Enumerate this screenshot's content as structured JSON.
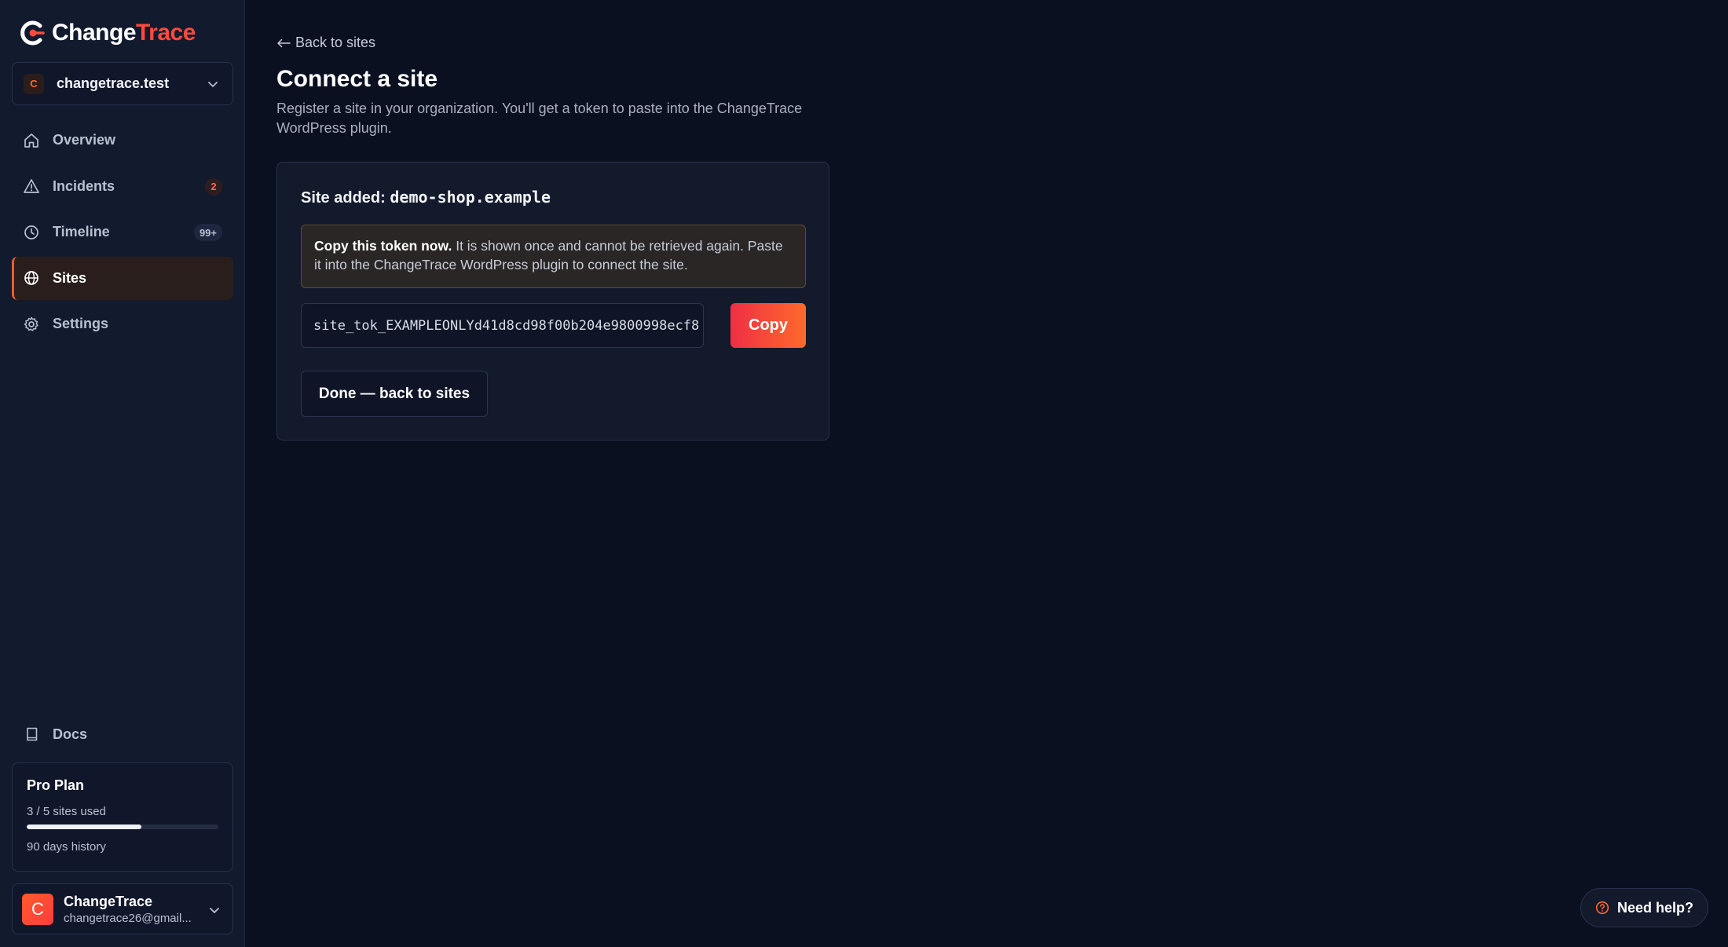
{
  "brand": {
    "name_part1": "Change",
    "name_part2": "Trace",
    "accent": "#ff4a3d"
  },
  "org": {
    "avatar_letter": "C",
    "name": "changetrace.test"
  },
  "nav": [
    {
      "label": "Overview",
      "icon": "home-icon",
      "badge": ""
    },
    {
      "label": "Incidents",
      "icon": "warning-icon",
      "badge": "2"
    },
    {
      "label": "Timeline",
      "icon": "clock-icon",
      "badge": "99+"
    },
    {
      "label": "Sites",
      "icon": "globe-icon",
      "badge": "",
      "active": true
    },
    {
      "label": "Settings",
      "icon": "gear-icon",
      "badge": ""
    }
  ],
  "docs": {
    "label": "Docs",
    "icon": "book-icon"
  },
  "plan": {
    "title": "Pro Plan",
    "usage": "3 / 5 sites used",
    "used": 3,
    "total": 5,
    "history": "90 days history"
  },
  "account": {
    "avatar_letter": "C",
    "name": "ChangeTrace",
    "email": "changetrace26@gmail..."
  },
  "page": {
    "back_label": "Back to sites",
    "title": "Connect a site",
    "description": "Register a site in your organization. You'll get a token to paste into the ChangeTrace WordPress plugin."
  },
  "card": {
    "head_prefix": "Site added:",
    "site_name": "demo-shop.example",
    "warning_bold": "Copy this token now.",
    "warning_text": "It is shown once and cannot be retrieved again. Paste it into the ChangeTrace WordPress plugin to connect the site.",
    "token": "site_tok_EXAMPLEONLYd41d8cd98f00b204e9800998ecf8",
    "copy_label": "Copy",
    "done_label": "Done — back to sites"
  },
  "help": {
    "label": "Need help?",
    "icon": "help-circle-icon"
  }
}
